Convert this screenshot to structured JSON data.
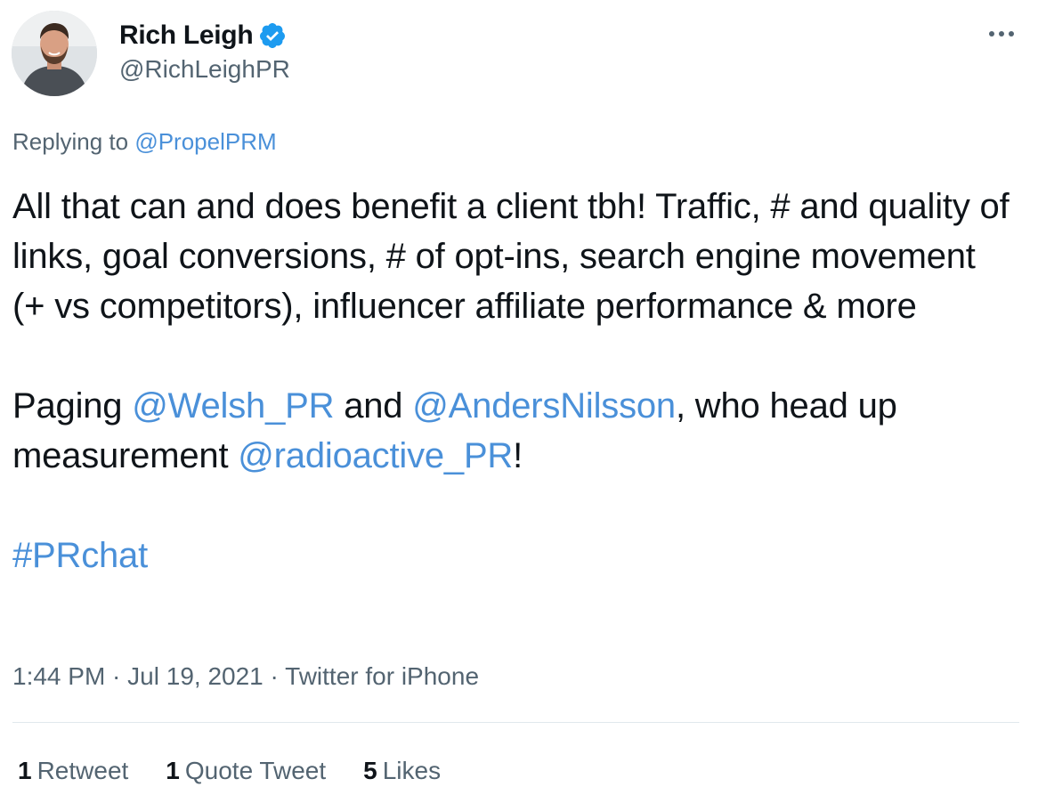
{
  "author": {
    "display_name": "Rich Leigh",
    "handle": "@RichLeighPR",
    "verified": true
  },
  "reply": {
    "prefix": "Replying to ",
    "mention": "@PropelPRM"
  },
  "body": {
    "line1": "All that can and does benefit a client tbh! Traffic, # and quality of links, goal conversions, # of opt-ins, search engine movement (+ vs competitors), influencer affiliate performance & more",
    "p2_text1": "Paging ",
    "p2_mention1": "@Welsh_PR",
    "p2_text2": " and ",
    "p2_mention2": "@AndersNilsson",
    "p2_text3": ", who head up measurement ",
    "p2_mention3": "@radioactive_PR",
    "p2_text4": "!",
    "hashtag": "#PRchat"
  },
  "meta": {
    "time": "1:44 PM",
    "sep1": " · ",
    "date": "Jul 19, 2021",
    "sep2": " · ",
    "source": "Twitter for iPhone"
  },
  "stats": {
    "retweets_count": "1",
    "retweets_label": "Retweet",
    "quotes_count": "1",
    "quotes_label": "Quote Tweet",
    "likes_count": "5",
    "likes_label": "Likes"
  },
  "colors": {
    "link": "#4a90d9",
    "verified": "#1d9bf0",
    "secondary_text": "#536471"
  }
}
